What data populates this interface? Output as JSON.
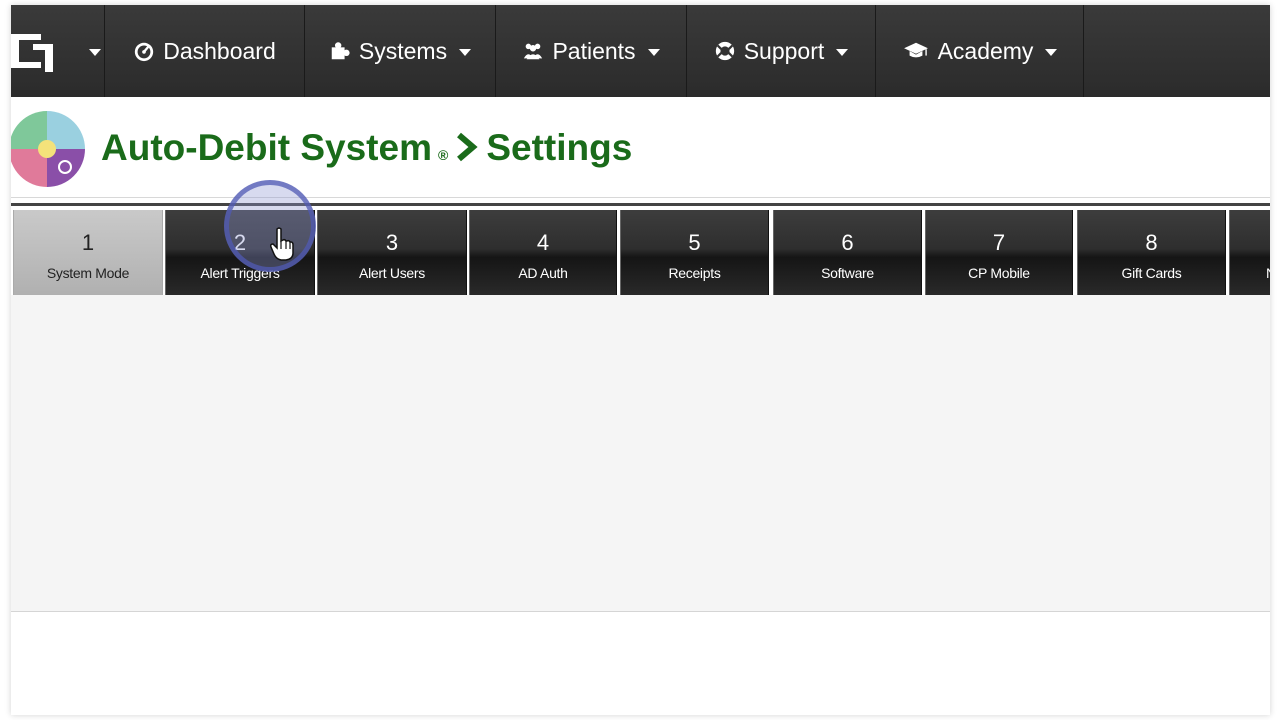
{
  "nav": {
    "items": [
      {
        "label": "Dashboard",
        "icon": "dashboard-icon",
        "dropdown": false
      },
      {
        "label": "Systems",
        "icon": "puzzle-piece-icon",
        "dropdown": true
      },
      {
        "label": "Patients",
        "icon": "users-icon",
        "dropdown": true
      },
      {
        "label": "Support",
        "icon": "life-ring-icon",
        "dropdown": true
      },
      {
        "label": "Academy",
        "icon": "graduation-cap-icon",
        "dropdown": true
      }
    ]
  },
  "header": {
    "system_name": "Auto-Debit System",
    "registered_mark": "®",
    "page_name": "Settings"
  },
  "tabs": [
    {
      "num": "1",
      "label": "System Mode",
      "active": true
    },
    {
      "num": "2",
      "label": "Alert Triggers",
      "active": false
    },
    {
      "num": "3",
      "label": "Alert Users",
      "active": false
    },
    {
      "num": "4",
      "label": "AD Auth",
      "active": false
    },
    {
      "num": "5",
      "label": "Receipts",
      "active": false
    },
    {
      "num": "6",
      "label": "Software",
      "active": false
    },
    {
      "num": "7",
      "label": "CP Mobile",
      "active": false
    },
    {
      "num": "8",
      "label": "Gift Cards",
      "active": false
    },
    {
      "num": "",
      "label": "N",
      "active": false
    }
  ],
  "colors": {
    "title_green": "#1a6b1a",
    "nav_bg": "#333333",
    "active_tab": "#bdbdbd"
  }
}
